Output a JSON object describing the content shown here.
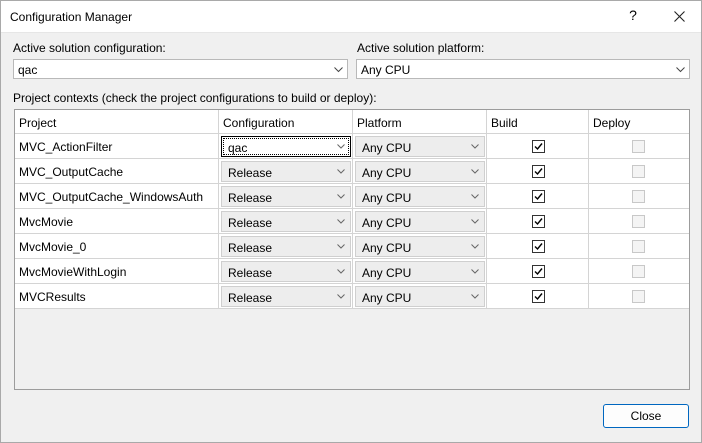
{
  "window": {
    "title": "Configuration Manager",
    "help_label": "?"
  },
  "solution": {
    "config_label": "Active solution configuration:",
    "config_value": "qac",
    "platform_label": "Active solution platform:",
    "platform_value": "Any CPU"
  },
  "contexts": {
    "label": "Project contexts (check the project configurations to build or deploy):",
    "columns": [
      "Project",
      "Configuration",
      "Platform",
      "Build",
      "Deploy"
    ],
    "rows": [
      {
        "project": "MVC_ActionFilter",
        "configuration": "qac",
        "platform": "Any CPU",
        "build": true,
        "deploy": false
      },
      {
        "project": "MVC_OutputCache",
        "configuration": "Release",
        "platform": "Any CPU",
        "build": true,
        "deploy": false
      },
      {
        "project": "MVC_OutputCache_WindowsAuth",
        "configuration": "Release",
        "platform": "Any CPU",
        "build": true,
        "deploy": false
      },
      {
        "project": "MvcMovie",
        "configuration": "Release",
        "platform": "Any CPU",
        "build": true,
        "deploy": false
      },
      {
        "project": "MvcMovie_0",
        "configuration": "Release",
        "platform": "Any CPU",
        "build": true,
        "deploy": false
      },
      {
        "project": "MvcMovieWithLogin",
        "configuration": "Release",
        "platform": "Any CPU",
        "build": true,
        "deploy": false
      },
      {
        "project": "MVCResults",
        "configuration": "Release",
        "platform": "Any CPU",
        "build": true,
        "deploy": false
      }
    ]
  },
  "footer": {
    "close_label": "Close"
  },
  "icons": {
    "close": "close-icon",
    "dropdown": "chevron-down-icon",
    "check": "checkmark-icon"
  },
  "colors": {
    "accent": "#0067c0",
    "window_bg": "#f0f0f0"
  }
}
